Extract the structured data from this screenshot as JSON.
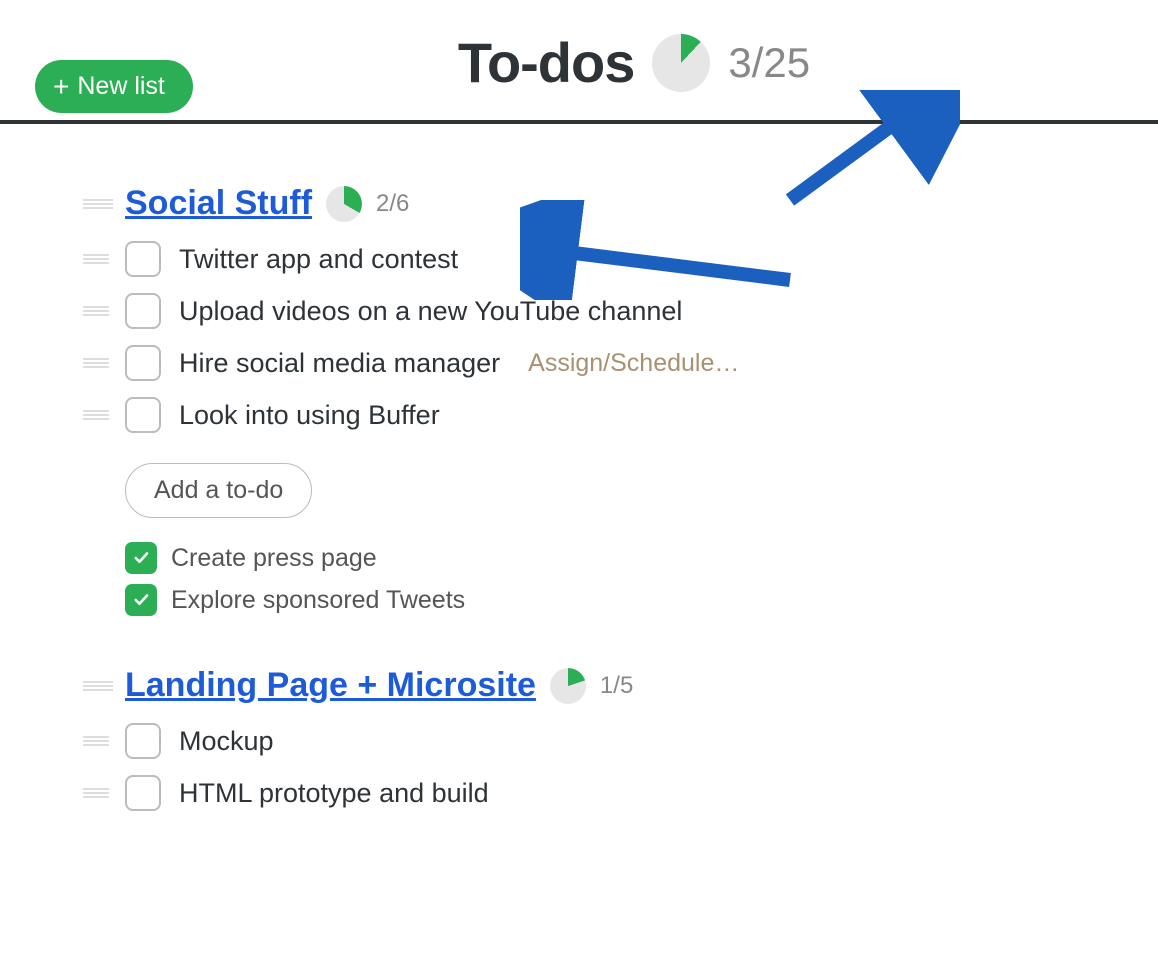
{
  "colors": {
    "green": "#2cae54",
    "blue": "#1e5bd8",
    "arrow": "#1b5fbf",
    "pieBg": "#e6e6e6"
  },
  "header": {
    "new_list_label": "New list",
    "title": "To-dos",
    "completed": 3,
    "total": 25,
    "ratio_text": "3/25"
  },
  "lists": [
    {
      "id": "social",
      "title": "Social Stuff",
      "completed": 2,
      "total": 6,
      "ratio_text": "2/6",
      "todos": [
        {
          "text": "Twitter app and contest",
          "assign": ""
        },
        {
          "text": "Upload videos on a new YouTube channel",
          "assign": ""
        },
        {
          "text": "Hire social media manager",
          "assign": "Assign/Schedule…"
        },
        {
          "text": "Look into using Buffer",
          "assign": ""
        }
      ],
      "add_button": "Add a to-do",
      "done": [
        {
          "text": "Create press page"
        },
        {
          "text": "Explore sponsored Tweets"
        }
      ]
    },
    {
      "id": "landing",
      "title": "Landing Page + Microsite",
      "completed": 1,
      "total": 5,
      "ratio_text": "1/5",
      "todos": [
        {
          "text": "Mockup",
          "assign": ""
        },
        {
          "text": "HTML prototype and build",
          "assign": ""
        }
      ],
      "add_button": "",
      "done": []
    }
  ]
}
